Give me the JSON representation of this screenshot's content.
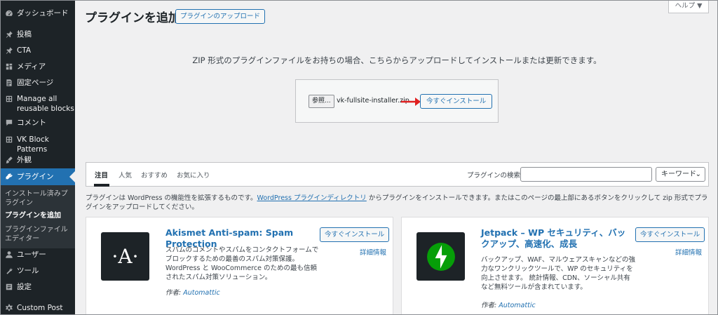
{
  "sidebar": {
    "items": [
      {
        "label": "ダッシュボード",
        "icon": "dashboard-icon"
      },
      {
        "label": "投稿",
        "icon": "pin-icon"
      },
      {
        "label": "CTA",
        "icon": "pin-icon"
      },
      {
        "label": "メディア",
        "icon": "media-icon"
      },
      {
        "label": "固定ページ",
        "icon": "page-icon"
      },
      {
        "label": "Manage all reusable blocks",
        "icon": "blocks-icon"
      },
      {
        "label": "コメント",
        "icon": "comment-icon"
      },
      {
        "label": "VK Block Patterns",
        "icon": "blocks-icon"
      },
      {
        "label": "外観",
        "icon": "brush-icon"
      },
      {
        "label": "プラグイン",
        "icon": "plugin-icon"
      },
      {
        "label": "ユーザー",
        "icon": "user-icon"
      },
      {
        "label": "ツール",
        "icon": "wrench-icon"
      },
      {
        "label": "設定",
        "icon": "settings-icon"
      },
      {
        "label": "Custom Post Type",
        "icon": "gear-icon"
      }
    ],
    "submenu": [
      {
        "label": "インストール済みプラグイン"
      },
      {
        "label": "プラグインを追加"
      },
      {
        "label": "プラグインファイルエディター"
      }
    ]
  },
  "header": {
    "title": "プラグインを追加",
    "upload_button": "プラグインのアップロード",
    "help": "ヘルプ ▼"
  },
  "upload": {
    "description": "ZIP 形式のプラグインファイルをお持ちの場合、こちらからアップロードしてインストールまたは更新できます。",
    "browse": "参照...",
    "file_name": "vk-fullsite-installer.zip",
    "install_button": "今すぐインストール"
  },
  "filter": {
    "tabs": [
      "注目",
      "人気",
      "おすすめ",
      "お気に入り"
    ],
    "search_label": "プラグインの検索",
    "search_value": "",
    "search_type": "キーワード",
    "chevron": "⌄"
  },
  "intro": {
    "text_before": "プラグインは WordPress の機能性を拡張するものです。",
    "link": "WordPress プラグインディレクトリ",
    "text_after": " からプラグインをインストールできます。またはこのページの最上部にあるボタンをクリックして zip 形式でプラグインをアップロードしてください。"
  },
  "plugins": [
    {
      "name": "Akismet Anti-spam: Spam Protection",
      "description": "スパムのコメントやスパムをコンタクトフォームでブロックするための最善のスパム対策保護。WordPress と WooCommerce のための最も信頼されたスパム対策ソリューション。",
      "install": "今すぐインストール",
      "details": "詳細情報",
      "author_label": "作者: ",
      "author": "Automattic",
      "icon_text": "·A·"
    },
    {
      "name": "Jetpack – WP セキュリティ、バックアップ、高速化、成長",
      "description": "バックアップ、WAF、マルウェアスキャンなどの強力なワンクリックツールで、WP のセキュリティを向上させます。 統計情報、CDN、ソーシャル共有など無料ツールが含まれています。",
      "install": "今すぐインストール",
      "details": "詳細情報",
      "author_label": "作者: ",
      "author": "Automattic"
    }
  ],
  "colors": {
    "accent": "#2271b1",
    "sidebar": "#1d2327",
    "active": "#2271b1",
    "arrow": "#e02020",
    "jetpack": "#069e08"
  }
}
